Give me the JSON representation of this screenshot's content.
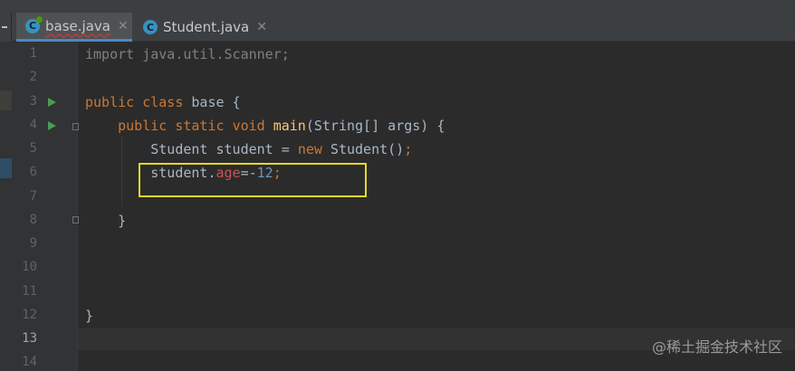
{
  "tabs": [
    {
      "label": "base.java",
      "icon": "java-class-icon",
      "active": true
    },
    {
      "label": "Student.java",
      "icon": "java-class-icon",
      "active": false
    }
  ],
  "close_glyph": "✕",
  "gutter": {
    "line_numbers": [
      "1",
      "2",
      "3",
      "4",
      "5",
      "6",
      "7",
      "8",
      "9",
      "10",
      "11",
      "12",
      "13",
      "14"
    ],
    "current_line": "13"
  },
  "code": {
    "line1": {
      "kw": "import",
      "rest": " java.util.Scanner;"
    },
    "line3": {
      "kw1": "public",
      "kw2": "class",
      "name": " base {"
    },
    "line4": {
      "kw1": "public",
      "kw2": "static",
      "kw3": "void",
      "fn": "main",
      "rest": "(String[] args) {"
    },
    "line5": {
      "a": "Student student = ",
      "kw": "new",
      "b": " Student()",
      "semi": ";"
    },
    "line6": {
      "obj": "student.",
      "field": "age",
      "op": "=-",
      "num": "12",
      "semi": ";"
    },
    "line8": {
      "text": "}"
    },
    "line12": {
      "text": "}"
    }
  },
  "watermark": "@稀土掘金技术社区",
  "colors": {
    "background": "#2b2b2b",
    "keyword": "#cc7832",
    "function": "#ffc66d",
    "field": "#9876aa",
    "number": "#6897bb",
    "highlight_box": "#e5d829"
  }
}
